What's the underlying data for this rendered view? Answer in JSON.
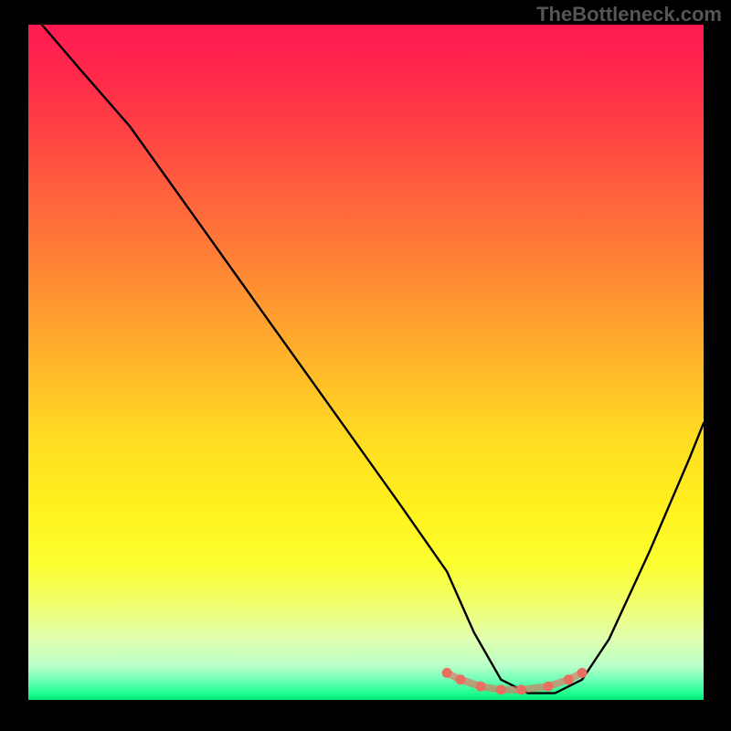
{
  "watermark": "TheBottleneck.com",
  "chart_data": {
    "type": "line",
    "title": "",
    "xlabel": "",
    "ylabel": "",
    "xlim": [
      0,
      100
    ],
    "ylim": [
      0,
      100
    ],
    "note": "Axes are unlabeled; values are normalized 0–100 estimated from pixel positions. Curve depicts a bottleneck/mismatch metric that descends from upper-left, reaches a flat minimum near x≈68–80, then rises.",
    "series": [
      {
        "name": "curve",
        "x": [
          2,
          8,
          15,
          25,
          35,
          45,
          55,
          62,
          66,
          70,
          74,
          78,
          82,
          86,
          92,
          98,
          100
        ],
        "values": [
          100,
          93,
          85,
          71,
          57,
          43,
          29,
          19,
          10,
          3,
          1,
          1,
          3,
          9,
          22,
          36,
          41
        ]
      },
      {
        "name": "highlight-dots",
        "x": [
          62,
          64,
          67,
          70,
          73,
          77,
          80,
          82
        ],
        "values": [
          4,
          3,
          2,
          1.5,
          1.5,
          2,
          3,
          4
        ]
      }
    ],
    "colors": {
      "curve": "#000000",
      "dots": "#e77062",
      "background_top": "#ff1a52",
      "background_bottom": "#00e878",
      "frame": "#000000"
    }
  }
}
